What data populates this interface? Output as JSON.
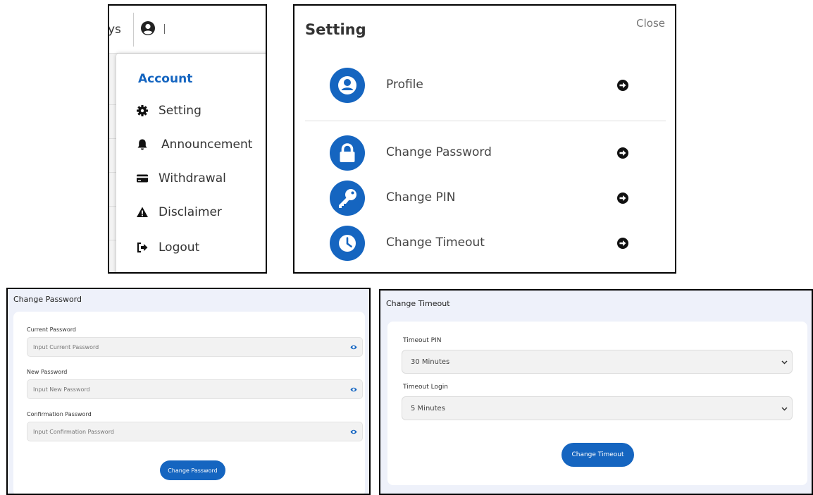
{
  "colors": {
    "accent": "#1565c0",
    "panel_bg": "#eef1fa"
  },
  "account_menu": {
    "nav_truncated": "ys",
    "user_icon": "user-circle-icon",
    "title": "Account",
    "items": [
      {
        "label": "Setting",
        "icon": "gear-icon"
      },
      {
        "label": "Announcement",
        "icon": "bell-icon"
      },
      {
        "label": "Withdrawal",
        "icon": "credit-card-icon"
      },
      {
        "label": "Disclaimer",
        "icon": "warning-icon"
      },
      {
        "label": "Logout",
        "icon": "logout-icon"
      }
    ]
  },
  "setting_dialog": {
    "title": "Setting",
    "close_label": "Close",
    "items": [
      {
        "label": "Profile",
        "icon": "profile-icon"
      },
      {
        "label": "Change Password",
        "icon": "lock-icon"
      },
      {
        "label": "Change PIN",
        "icon": "key-icon"
      },
      {
        "label": "Change Timeout",
        "icon": "clock-icon"
      }
    ]
  },
  "change_password": {
    "title": "Change Password",
    "fields": [
      {
        "label": "Current Password",
        "placeholder": "Input Current Password"
      },
      {
        "label": "New Password",
        "placeholder": "Input New Password"
      },
      {
        "label": "Confirmation Password",
        "placeholder": "Input Confirmation Password"
      }
    ],
    "submit_label": "Change Password"
  },
  "change_timeout": {
    "title": "Change Timeout",
    "fields": [
      {
        "label": "Timeout PIN",
        "selected": "30 Minutes"
      },
      {
        "label": "Timeout Login",
        "selected": "5 Minutes"
      }
    ],
    "submit_label": "Change Timeout"
  }
}
